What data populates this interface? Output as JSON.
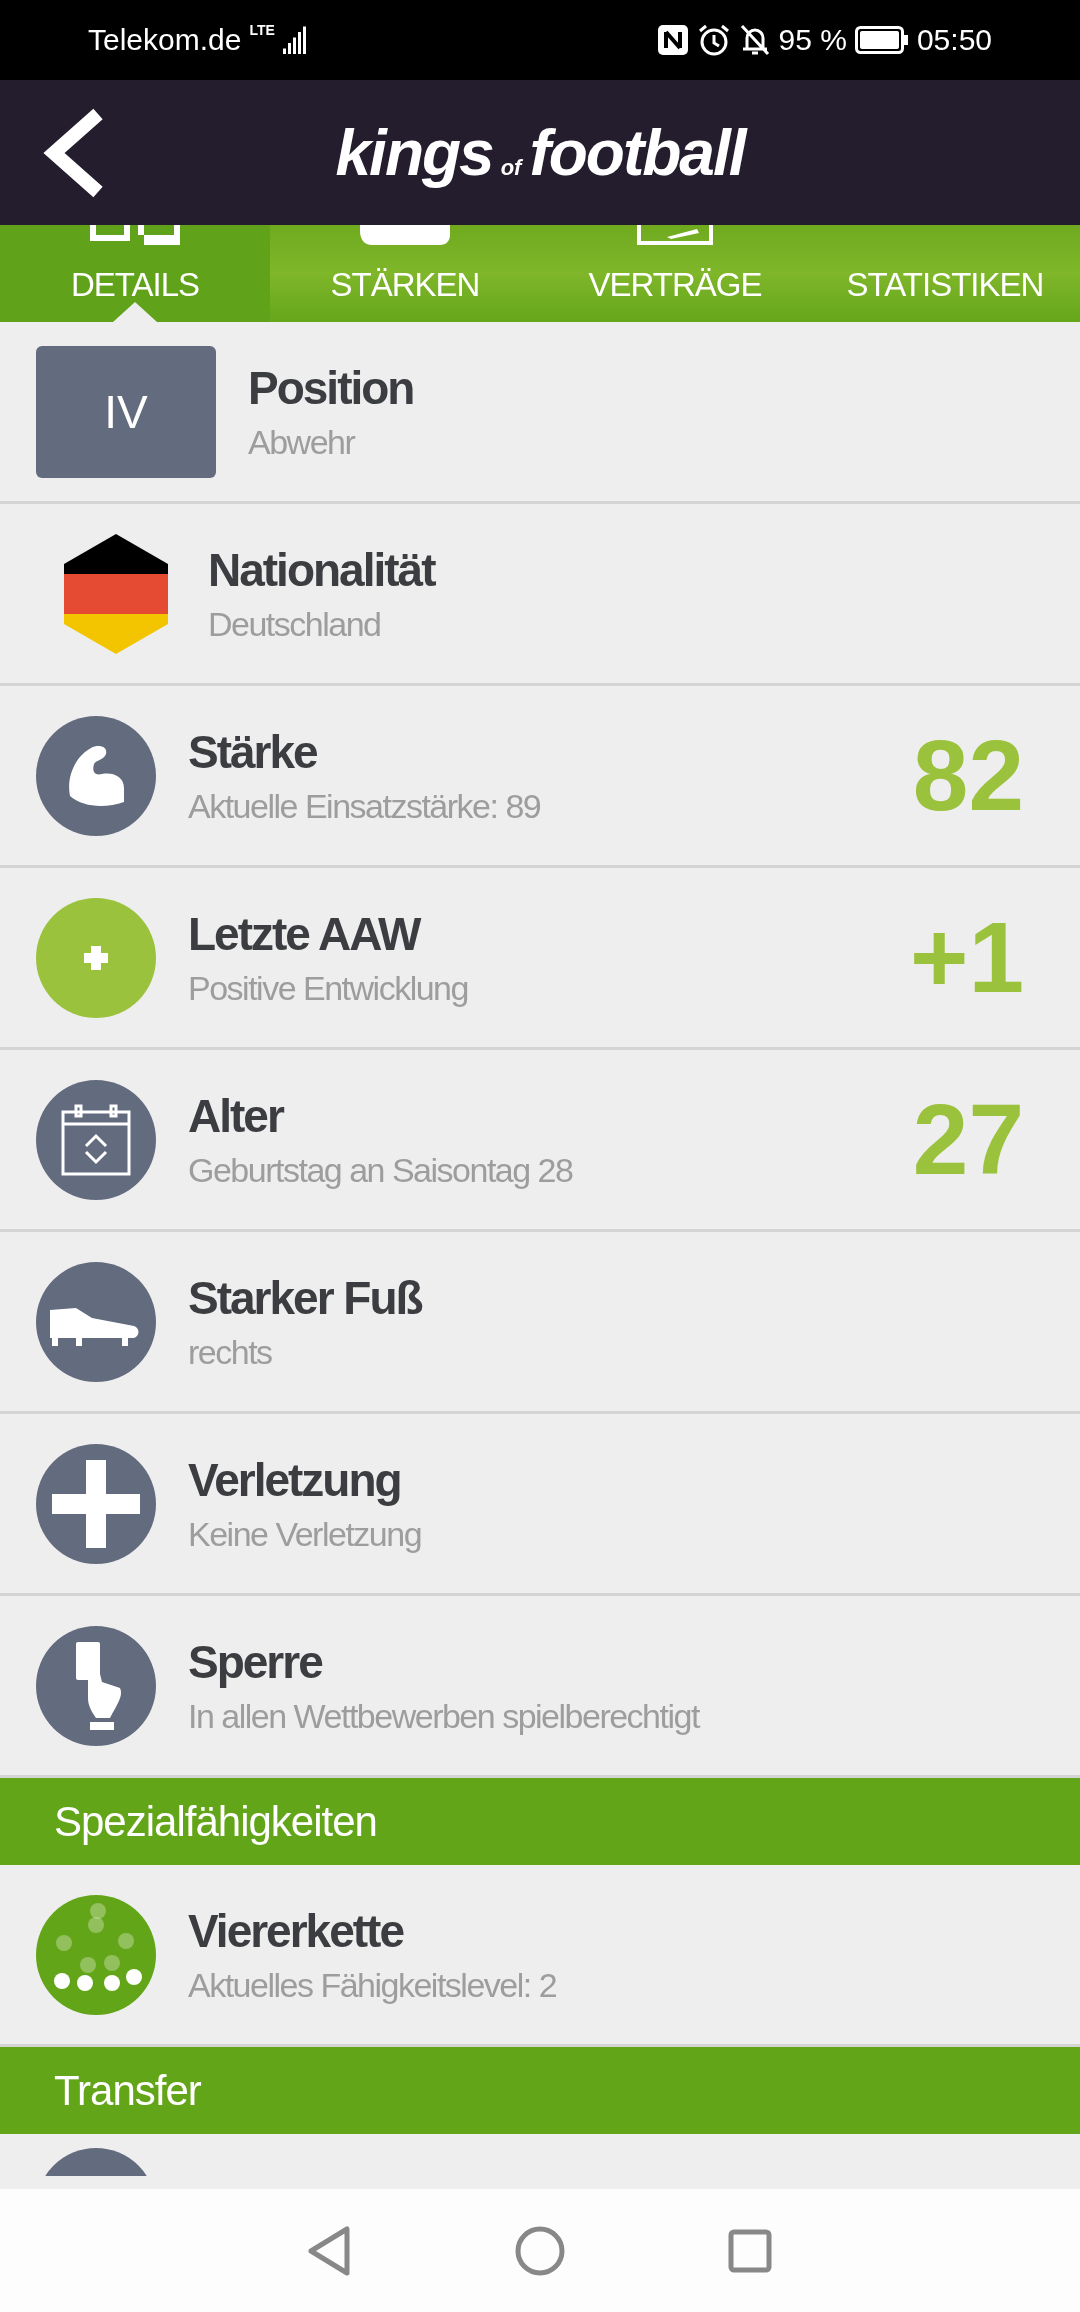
{
  "status_bar": {
    "carrier": "Telekom.de",
    "network": "LTE",
    "battery": "95 %",
    "time": "05:50"
  },
  "header": {
    "logo_main": "kings",
    "logo_small": "of",
    "logo_end": "football"
  },
  "tabs": [
    {
      "label": "DETAILS",
      "selected": true
    },
    {
      "label": "STÄRKEN",
      "selected": false
    },
    {
      "label": "VERTRÄGE",
      "selected": false
    },
    {
      "label": "STATISTIKEN",
      "selected": false
    }
  ],
  "details": [
    {
      "kind": "badge",
      "badge": "IV",
      "title": "Position",
      "subtitle": "Abwehr"
    },
    {
      "kind": "flag",
      "title": "Nationalität",
      "subtitle": "Deutschland"
    },
    {
      "kind": "muscle",
      "title": "Stärke",
      "subtitle": "Aktuelle Einsatzstärke: 89",
      "value": "82"
    },
    {
      "kind": "plus",
      "title": "Letzte AAW",
      "subtitle": "Positive Entwicklung",
      "value": "+1"
    },
    {
      "kind": "calendar",
      "title": "Alter",
      "subtitle": "Geburtstag an Saisontag 28",
      "value": "27"
    },
    {
      "kind": "boot",
      "title": "Starker Fuß",
      "subtitle": "rechts"
    },
    {
      "kind": "cross",
      "title": "Verletzung",
      "subtitle": "Keine Verletzung"
    },
    {
      "kind": "card",
      "title": "Sperre",
      "subtitle": "In allen Wettbewerben spielberechtigt"
    }
  ],
  "special_section": {
    "title": "Spezialfähigkeiten",
    "items": [
      {
        "kind": "dots",
        "title": "Viererkette",
        "subtitle": "Aktuelles Fähigkeitslevel: 2"
      }
    ]
  },
  "transfer_section": {
    "title": "Transfer"
  }
}
